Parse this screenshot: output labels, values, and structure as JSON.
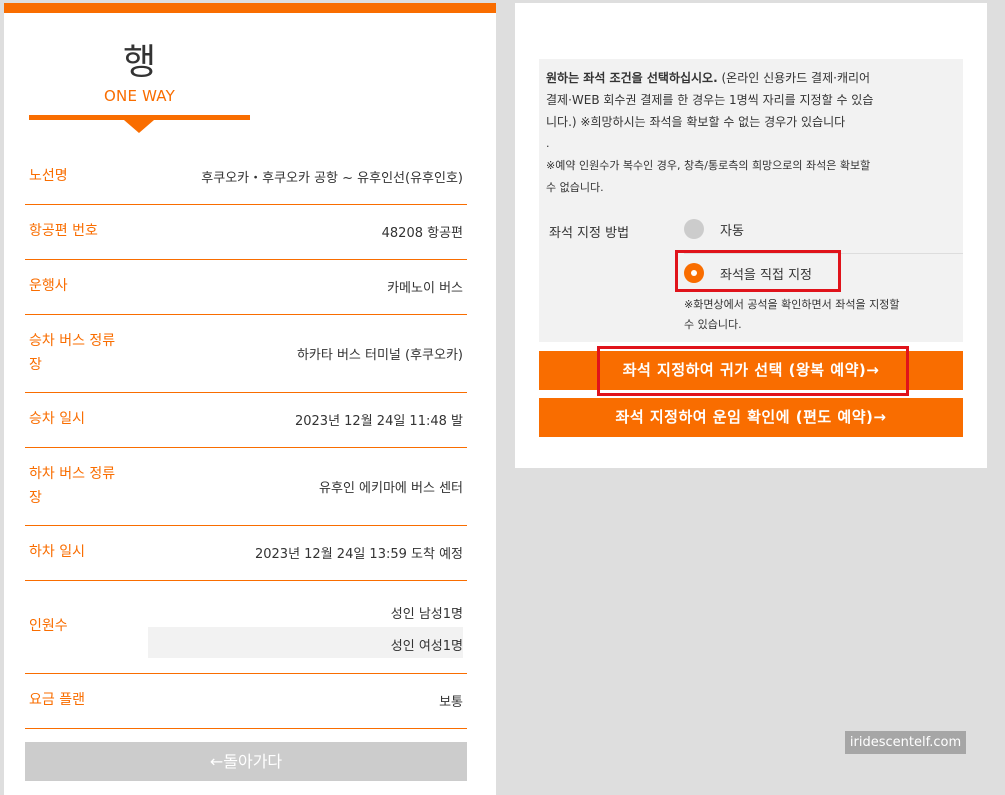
{
  "hero": {
    "title_kor": "행",
    "title_eng": "ONE WAY"
  },
  "trip": {
    "route_label": "노선명",
    "route_value": "후쿠오카・후쿠오카 공항 ~ 유후인선(유후인호)",
    "flight_label": "항공편 번호",
    "flight_value": "48208 항공편",
    "operator_label": "운행사",
    "operator_value": "카메노이 버스",
    "board_stop_label_1": "승차 버스 정류",
    "board_stop_label_2": "장",
    "board_stop_value": "하카타 버스 터미널 (후쿠오카)",
    "board_time_label": "승차 일시",
    "board_time_value": "2023년 12월 24일 11:48 발",
    "alight_stop_label_1": "하차 버스 정류",
    "alight_stop_label_2": "장",
    "alight_stop_value": "유후인 에키마에 버스 센터",
    "alight_time_label": "하차 일시",
    "alight_time_value": "2023년 12월 24일 13:59 도착 예정",
    "pax_label": "인원수",
    "pax_values": [
      "성인 남성1명",
      "성인 여성1명"
    ],
    "fare_label": "요금 플랜",
    "fare_value": "보통"
  },
  "back_button": "←돌아가다",
  "conditions": {
    "bold_part": "원하는 좌석 조건을 선택하십시오.",
    "line1_rest": " (온라인 신용카드 결제·캐리어",
    "line2": "결제·WEB 회수권 결제를 한 경우는 1명씩 자리를 지정할 수 있습",
    "line3": "니다.) ※희망하시는 좌석을 확보할 수 없는 경우가 있습니다",
    "dot": ".",
    "note1": "※예약 인원수가 복수인 경우, 창측/통로측의 희망으로의 좌석은 확보할",
    "note2": "수 없습니다.",
    "seat_method_label": "좌석 지정 방법",
    "option_auto": "자동",
    "option_manual": "좌석을 직접 지정",
    "manual_note1": "※화면상에서 공석을 확인하면서 좌석을 지정할",
    "manual_note2": "수 있습니다."
  },
  "buttons": {
    "round_trip": "좌석 지정하여 귀가 선택 (왕복 예약)→",
    "one_way": "좌석 지정하여 운임 확인에 (편도 예약)→"
  },
  "colors": {
    "accent": "#f96d00",
    "highlight": "#e0131b"
  },
  "watermark": "iridescentelf.com"
}
